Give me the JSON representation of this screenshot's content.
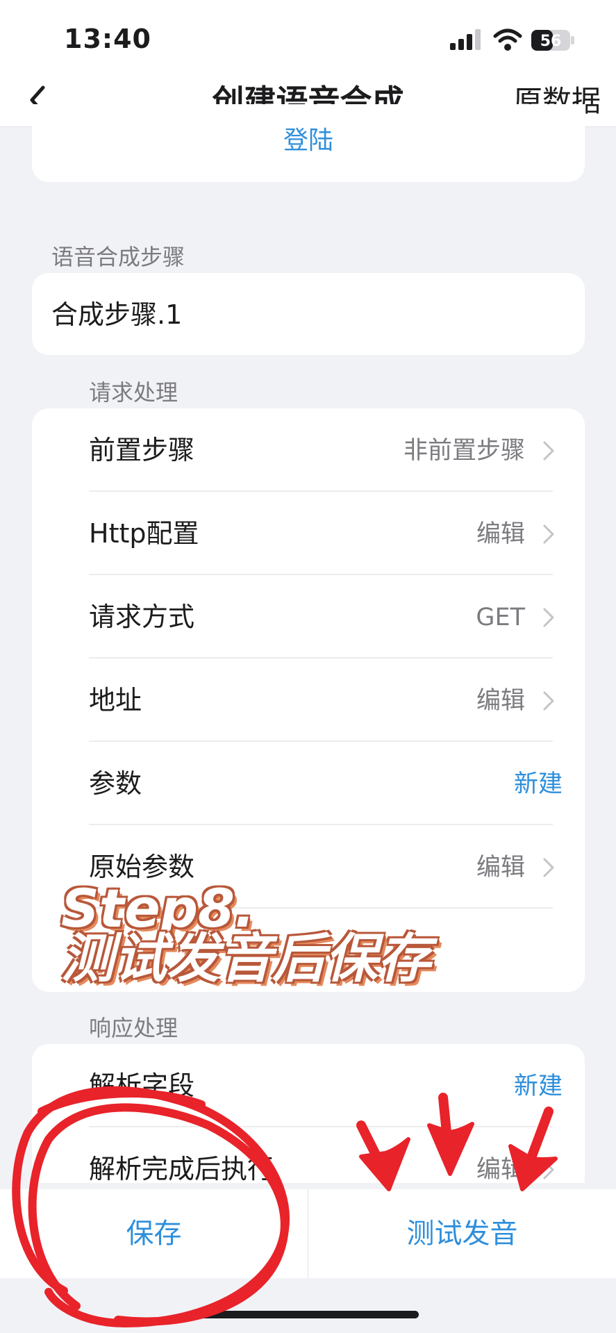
{
  "status_bar": {
    "time": "13:40",
    "battery": "56"
  },
  "nav": {
    "back_icon": "chevron-left-icon",
    "title": "创建语音合成",
    "right_action": "原数据"
  },
  "login": {
    "label": "登陆"
  },
  "steps_section": {
    "label": "语音合成步骤",
    "step_name": "合成步骤.1"
  },
  "request_section": {
    "label": "请求处理",
    "rows": [
      {
        "label": "前置步骤",
        "value": "非前置步骤",
        "chevron": true
      },
      {
        "label": "Http配置",
        "value": "编辑",
        "chevron": true
      },
      {
        "label": "请求方式",
        "value": "GET",
        "chevron": true
      },
      {
        "label": "地址",
        "value": "编辑",
        "chevron": true
      },
      {
        "label": "参数",
        "value": "新建",
        "chevron": false
      },
      {
        "label": "原始参数",
        "value": "编辑",
        "chevron": true
      }
    ]
  },
  "response_section": {
    "label": "响应处理",
    "rows": [
      {
        "label": "解析字段",
        "value": "新建",
        "chevron": false
      },
      {
        "label": "解析完成后执行",
        "value": "编辑",
        "chevron": true
      }
    ]
  },
  "bottom": {
    "save_label": "保存",
    "test_label": "测试发音"
  },
  "overlay": {
    "line1": "Step8.",
    "line2": "测试发音后保存"
  },
  "colors": {
    "accent": "#2f8fdb",
    "annotation_red": "#e8232a",
    "overlay_outline": "#b8583a"
  }
}
